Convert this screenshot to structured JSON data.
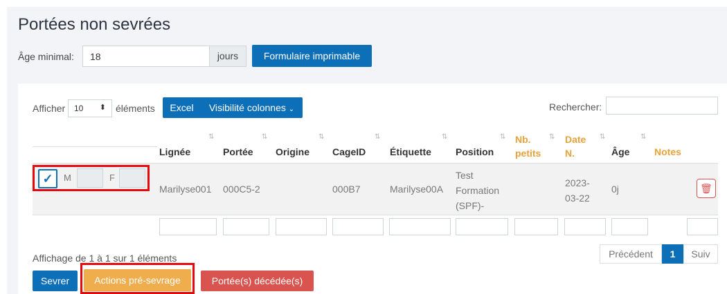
{
  "page": {
    "title": "Portées non sevrées"
  },
  "age": {
    "label": "Âge minimal:",
    "value": "18",
    "unit": "jours",
    "print_button": "Formulaire imprimable"
  },
  "table_controls": {
    "show_label": "Afficher",
    "show_value": "10",
    "show_after": "éléments",
    "excel_button": "Excel",
    "visibility_button": "Visibilité colonnes",
    "search_label": "Rechercher:"
  },
  "table": {
    "columns": {
      "lignee": "Lignée",
      "portee": "Portée",
      "origine": "Origine",
      "cageid": "CageID",
      "etiquette": "Étiquette",
      "position": "Position",
      "nb_petits_1": "Nb.",
      "nb_petits_2": "petits",
      "date_1": "Date",
      "date_2": "N.",
      "age": "Âge",
      "notes": "Notes"
    },
    "row": {
      "m_label": "M",
      "f_label": "F",
      "lignee": "Marilyse001",
      "portee": "000C5-2",
      "cageid": "000B7",
      "etiquette": "Marilyse00A",
      "position_1": "Test",
      "position_2": "Formation",
      "position_3": "(SPF)-",
      "date_1": "2023-",
      "date_2": "03-22",
      "age": "0j"
    }
  },
  "footer": {
    "info": "Affichage de 1 à 1 sur 1 éléments",
    "prev": "Précédent",
    "page": "1",
    "next": "Suiv"
  },
  "actions": {
    "serve": "Sevrer",
    "pre": "Actions pré-sevrage",
    "dead": "Portée(s) décédée(s)"
  },
  "colors": {
    "primary": "#0d6fb8",
    "warning": "#f0ad4e",
    "danger": "#d9534f",
    "header_accent": "#e8a23a",
    "highlight": "#e8080c"
  }
}
